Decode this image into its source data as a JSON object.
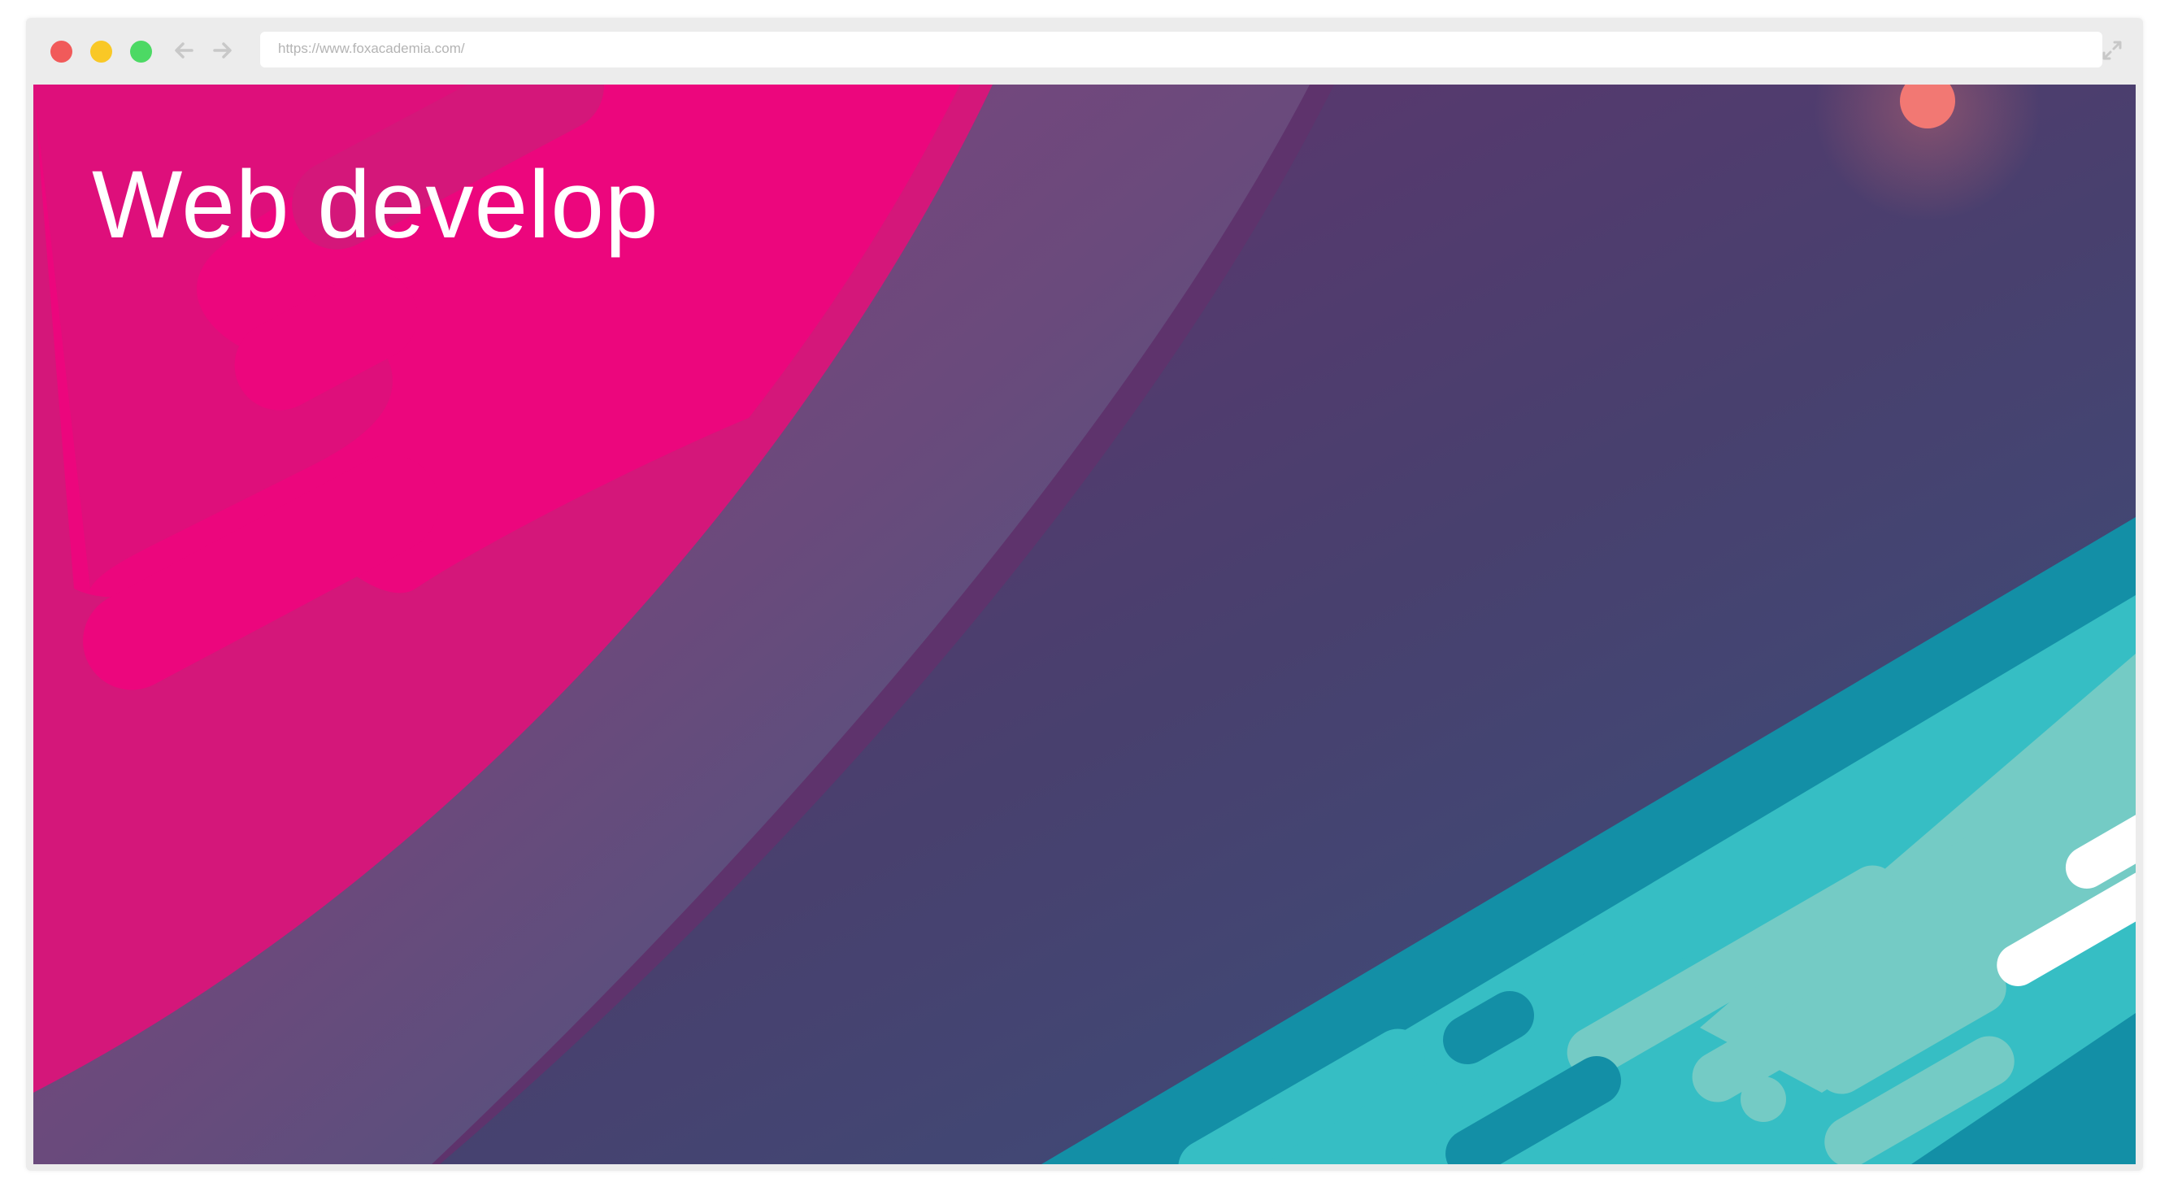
{
  "browser": {
    "address_bar": {
      "url": "https://www.foxacademia.com/"
    },
    "buttons": {
      "close": "close-window-button",
      "minimize": "minimize-window-button",
      "maximize": "maximize-window-button"
    },
    "icons": {
      "back": "arrow-left-icon",
      "forward": "arrow-right-icon",
      "expand": "expand-icon"
    }
  },
  "page": {
    "hero_title": "Web develop"
  },
  "colors": {
    "magenta": "#ec067d",
    "pink_shade": "#d4177a",
    "band_purple": "#8a3f80",
    "band_blue": "#3d5a80",
    "deep_purple": "#5d336c",
    "navy_purple": "#43406c",
    "teal_dark": "#138fa6",
    "teal": "#36bec4",
    "teal_light": "#74cbc5",
    "coral": "#f27873"
  }
}
